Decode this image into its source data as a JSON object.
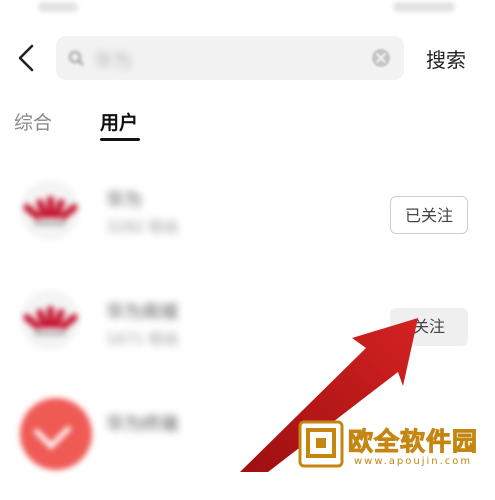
{
  "header": {
    "search_placeholder": "华为",
    "search_button": "搜索"
  },
  "tabs": [
    {
      "label": "综合",
      "active": false
    },
    {
      "label": "用户",
      "active": true
    }
  ],
  "users": [
    {
      "name": "华为",
      "subtitle": "3282 粉丝",
      "button": "已关注",
      "followed": true,
      "avatar": "huawei-logo"
    },
    {
      "name": "华为商城",
      "subtitle": "1671 粉丝",
      "button": "关注",
      "followed": false,
      "avatar": "huawei-logo"
    },
    {
      "name": "华为终端",
      "subtitle": "",
      "button": "",
      "followed": false,
      "avatar": "vivo-logo"
    }
  ],
  "watermark": {
    "text": "欧全软件园",
    "url": "www.apoujin.com"
  },
  "colors": {
    "arrow": "#c81a1a",
    "huawei_red": "#c4122e",
    "watermark_gold": "#c48610",
    "search_bg": "#f2f2f2"
  }
}
